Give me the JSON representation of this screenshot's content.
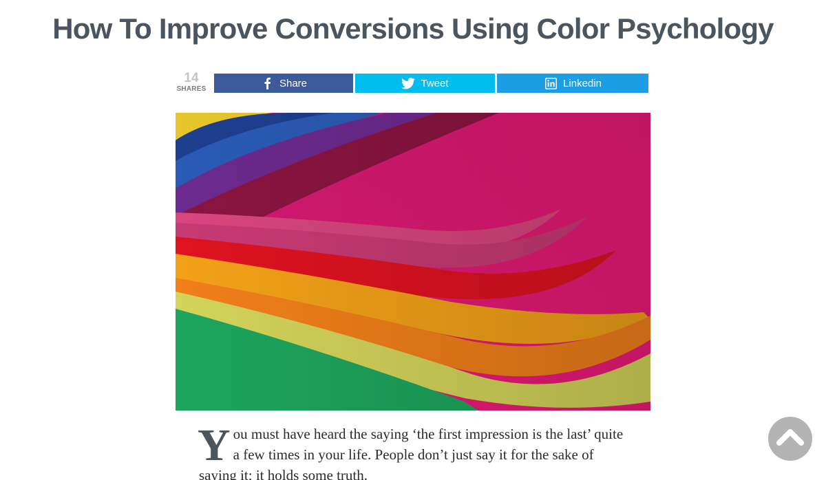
{
  "article": {
    "title": "How To Improve Conversions Using Color Psychology",
    "share_count": "14",
    "share_count_label": "SHARES",
    "drop_cap": "Y",
    "first_paragraph": "ou must have heard the saying ‘the first impression is the last’ quite a few times in your life. People don’t just say it for the sake of saying it; it holds some truth."
  },
  "share_buttons": [
    {
      "label": "Share",
      "icon": "facebook-icon",
      "color": "#3b5b9a"
    },
    {
      "label": "Tweet",
      "icon": "twitter-icon",
      "color": "#00bdf0"
    },
    {
      "label": "Linkedin",
      "icon": "linkedin-icon",
      "color": "#1b9ee4"
    }
  ],
  "hero_image": {
    "description_colors": [
      "#e8d52a",
      "#1f4fa0",
      "#7a2a8a",
      "#d6396f",
      "#e0131f",
      "#f2a11a",
      "#f07e1c",
      "#cdd85a",
      "#1ca85c",
      "#e8166f"
    ]
  },
  "scroll_top": {
    "icon": "chevron-up-icon",
    "color": "#b3b3b3"
  }
}
